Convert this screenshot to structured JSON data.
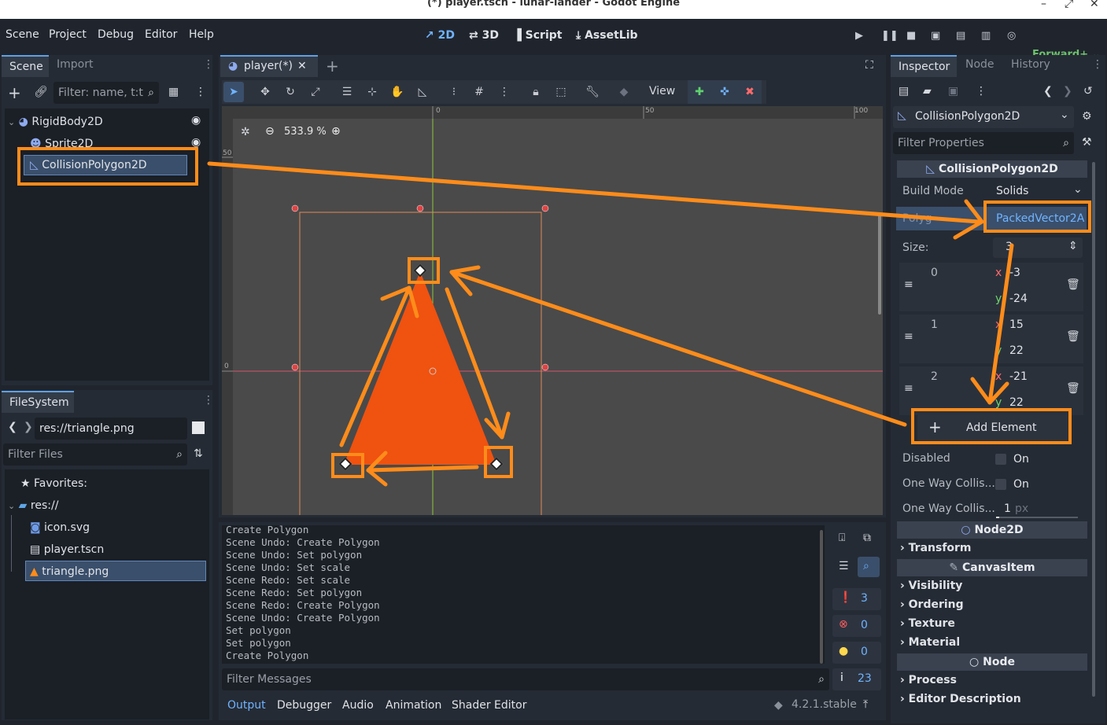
{
  "window": {
    "title": "(*) player.tscn - lunar-lander - Godot Engine",
    "minimize": "–",
    "maximize": "⤢",
    "close": "✕"
  },
  "menu": [
    "Scene",
    "Project",
    "Debug",
    "Editor",
    "Help"
  ],
  "workspaces": {
    "w2d": "2D",
    "w3d": "3D",
    "script": "Script",
    "assetlib": "AssetLib"
  },
  "renderer": "Forward+",
  "scene_dock": {
    "tabs": [
      "Scene",
      "Import"
    ],
    "filter_placeholder": "Filter: name, t:t",
    "nodes": [
      "RigidBody2D",
      "Sprite2D",
      "CollisionPolygon2D"
    ]
  },
  "filesystem_dock": {
    "tab": "FileSystem",
    "path": "res://triangle.png",
    "filter_placeholder": "Filter Files",
    "favorites": "Favorites:",
    "root": "res://",
    "files": [
      "icon.svg",
      "player.tscn",
      "triangle.png"
    ]
  },
  "editor_tab": {
    "label": "player(*)",
    "close": "✕",
    "add": "+"
  },
  "viewport": {
    "zoom": "533.9 %",
    "view_menu": "View",
    "ruler_marks": [
      "0",
      "50",
      "100"
    ],
    "ruler_left": [
      "50",
      "0"
    ]
  },
  "output": {
    "lines": [
      "Create Polygon",
      "Scene Undo: Create Polygon",
      "Scene Undo: Set polygon",
      "Scene Undo: Set scale",
      "Scene Redo: Set scale",
      "Scene Redo: Set polygon",
      "Scene Redo: Create Polygon",
      "Scene Undo: Create Polygon",
      "Set polygon",
      "Set polygon",
      "Create Polygon"
    ],
    "filter_placeholder": "Filter Messages",
    "counts": {
      "messages": "3",
      "errors": "0",
      "warnings": "0",
      "info": "23"
    },
    "bottom_tabs": [
      "Output",
      "Debugger",
      "Audio",
      "Animation",
      "Shader Editor"
    ],
    "version": "4.2.1.stable"
  },
  "inspector": {
    "tabs": [
      "Inspector",
      "Node",
      "History"
    ],
    "object": "CollisionPolygon2D",
    "filter_placeholder": "Filter Properties",
    "section": "CollisionPolygon2D",
    "build_mode_label": "Build Mode",
    "build_mode_value": "Solids",
    "polygon_label": "Polyg",
    "polygon_value": "PackedVector2A",
    "size_label": "Size:",
    "size_value": "3",
    "elements": [
      {
        "index": "0",
        "x": "-3",
        "y": "-24"
      },
      {
        "index": "1",
        "x": "15",
        "y": "22"
      },
      {
        "index": "2",
        "x": "-21",
        "y": "22"
      }
    ],
    "x_label": "x",
    "y_label": "y",
    "add_element": "Add Element",
    "disabled_label": "Disabled",
    "disabled_value": "On",
    "one_way_label": "One Way Collis...",
    "one_way_value": "On",
    "one_way_margin_label": "One Way Collis...",
    "one_way_margin_value": "1",
    "one_way_margin_unit": "px",
    "node2d": "Node2D",
    "transform": "Transform",
    "canvasitem": "CanvasItem",
    "visibility": "Visibility",
    "ordering": "Ordering",
    "texture": "Texture",
    "material": "Material",
    "node": "Node",
    "process": "Process",
    "editor_description": "Editor Description"
  },
  "colors": {
    "accent": "#70b3ff",
    "highlight": "#ff8c1a",
    "triangle": "#f0520f"
  }
}
